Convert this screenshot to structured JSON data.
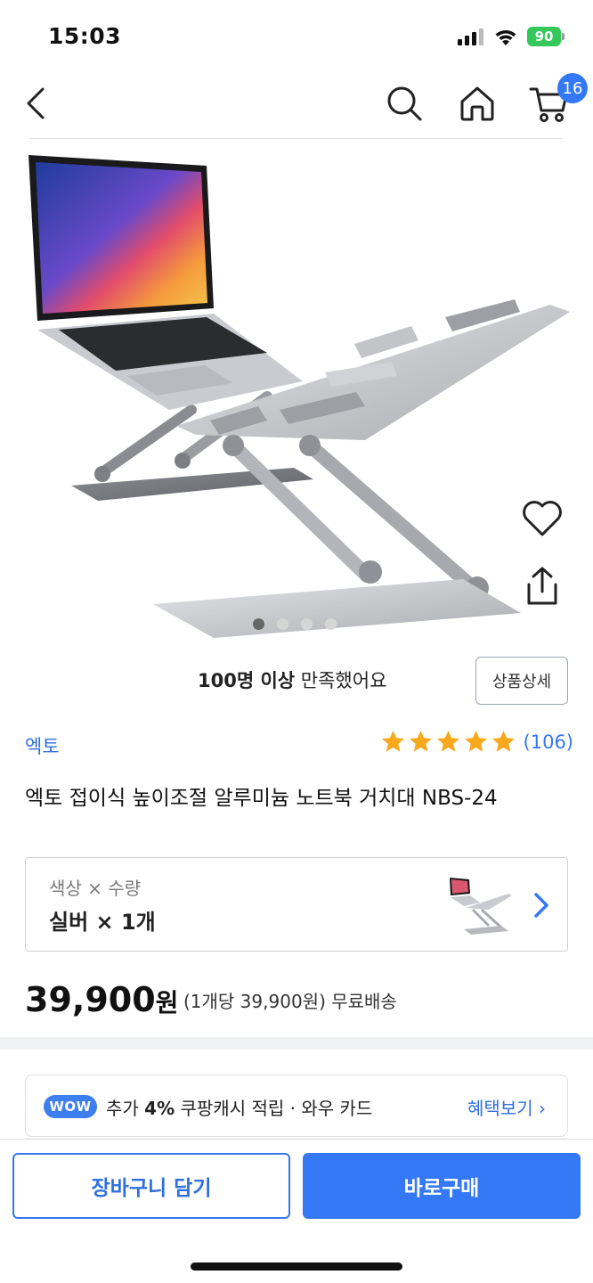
{
  "status_bar": {
    "time": "15:03",
    "battery": "90"
  },
  "nav": {
    "cart_count": "16"
  },
  "gallery": {
    "image_count": 4,
    "active_index": 0
  },
  "satisfaction": {
    "highlight": "100명 이상",
    "rest": "만족했어요"
  },
  "detail_button": "상품상세",
  "brand": "엑토",
  "rating": {
    "stars": 5,
    "count": "(106)"
  },
  "product_title": "엑토 접이식 높이조절 알루미늄 노트북 거치대 NBS-24",
  "option": {
    "label": "색상 × 수량",
    "value": "실버 × 1개"
  },
  "price": {
    "amount": "39,900",
    "unit": "원",
    "unit_price": "(1개당 39,900원) 무료배송"
  },
  "wow_banner": {
    "badge": "WOW",
    "prefix": "추가",
    "percent": "4%",
    "suffix": "쿠팡캐시 적립 · 와우 카드",
    "link": "혜택보기 ›"
  },
  "actions": {
    "cart": "장바구니 담기",
    "buy": "바로구매"
  },
  "colors": {
    "accent": "#3478f6",
    "star": "#f7a81b",
    "battery": "#34c759"
  }
}
